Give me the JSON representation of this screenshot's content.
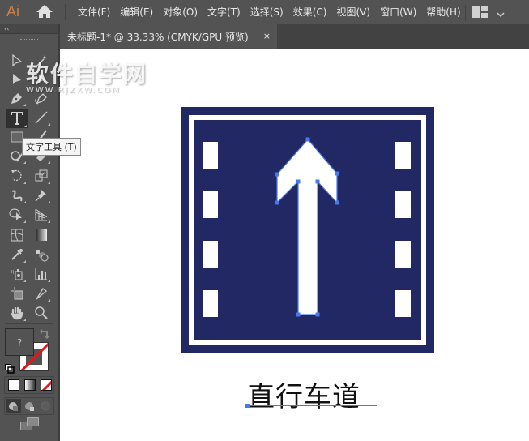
{
  "app": {
    "logo": "Ai",
    "home_icon": "home-icon",
    "menu": [
      "文件(F)",
      "编辑(E)",
      "对象(O)",
      "文字(T)",
      "选择(S)",
      "效果(C)",
      "视图(V)",
      "窗口(W)",
      "帮助(H)"
    ],
    "workspace_icon": "workspace-layout-icon"
  },
  "document_tab": {
    "title": "未标题-1* @ 33.33% (CMYK/GPU 预览)",
    "close_label": "×"
  },
  "toolbar": {
    "collapse_label": "‹‹",
    "active_tool": "type-tool",
    "tools": [
      "selection-tool",
      "magic-wand-tool",
      "direct-selection-tool",
      "group-selection-tool",
      "pen-tool",
      "curvature-tool",
      "type-tool",
      "line-segment-tool",
      "rectangle-tool",
      "paintbrush-tool",
      "shaper-tool",
      "eraser-tool",
      "rotate-tool",
      "scale-tool",
      "warp-tool",
      "pin-tool",
      "shape-builder-tool",
      "perspective-grid-tool",
      "mesh-tool",
      "gradient-tool",
      "eyedropper-tool",
      "blend-tool",
      "symbol-sprayer-tool",
      "column-graph-tool",
      "artboard-tool",
      "slice-tool",
      "hand-tool",
      "zoom-tool"
    ],
    "tooltip": "文字工具 (T)",
    "fill_label": "?",
    "colors": {
      "stroke_none": "#e8141c"
    }
  },
  "watermark": {
    "main": "软件自学网",
    "sub": "WWW.RJZXW.COM"
  },
  "artwork": {
    "sign_color": "#212864",
    "selection_color": "#4a78e8",
    "caption": "直行车道",
    "side_marks_per_side": 4
  }
}
